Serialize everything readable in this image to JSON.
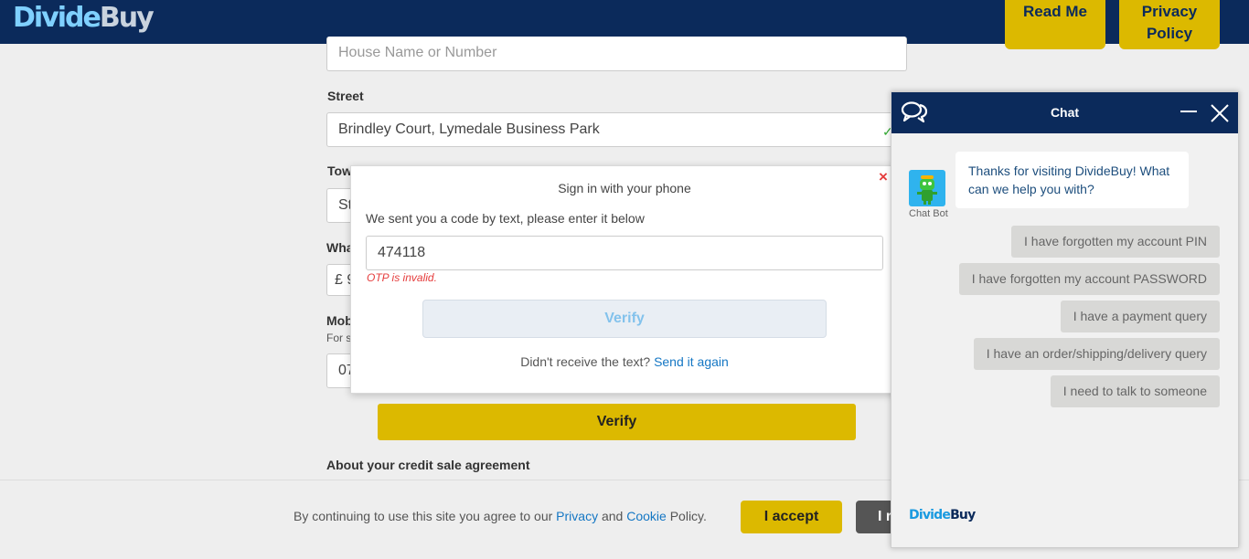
{
  "header": {
    "logo_part1": "Divide",
    "logo_part2": "Buy",
    "read_me": "Read Me",
    "privacy_policy": "Privacy Policy"
  },
  "form": {
    "house_placeholder": "House Name or Number",
    "street_label": "Street",
    "street_value": "Brindley Court, Lymedale Business Park",
    "town_label_partial": "Tow",
    "town_value_partial": "St",
    "what_label_partial": "Wha",
    "amount_value_partial": "£ 9",
    "mobile_label_partial": "Mob",
    "mobile_note_partial": "For s",
    "mobile_value_partial": "07",
    "verify_label": "Verify",
    "about_label": "About your credit sale agreement"
  },
  "modal": {
    "close_glyph": "×",
    "title": "Sign in with your phone",
    "instruction": "We sent you a code by text, please enter it below",
    "otp_value": "474118",
    "error": "OTP is invalid.",
    "verify_label": "Verify",
    "resend_text": "Didn't receive the text?",
    "resend_link": "Send it again"
  },
  "cookie": {
    "text_before": "By continuing to use this site you agree to our",
    "privacy_link": "Privacy",
    "and": "and",
    "cookie_link": "Cookie",
    "text_after": "Policy.",
    "accept_label": "I accept",
    "reject_partial": "I r"
  },
  "chat": {
    "title": "Chat",
    "bot_label": "Chat Bot",
    "bot_message": "Thanks for visiting DivideBuy! What can we help you with?",
    "quick_replies": [
      "I have forgotten my account PIN",
      "I have forgotten my account PASSWORD",
      "I have a payment query",
      "I have an order/shipping/delivery query",
      "I need to talk to someone"
    ],
    "footer_logo_part1": "Divide",
    "footer_logo_part2": "Buy"
  },
  "colors": {
    "navy": "#0b2a5b",
    "gold": "#dcb900",
    "link_blue": "#1577c4",
    "error_red": "#e53c3c"
  }
}
